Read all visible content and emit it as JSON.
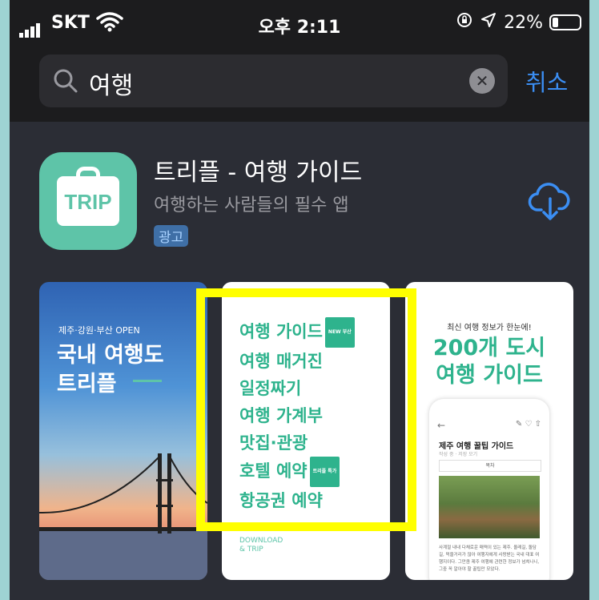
{
  "status_bar": {
    "carrier": "SKT",
    "time": "오후 2:11",
    "battery": "22%",
    "battery_level": 0.22
  },
  "search": {
    "query": "여행",
    "cancel_label": "취소"
  },
  "app": {
    "name": "트리플 - 여행 가이드",
    "subtitle": "여행하는 사람들의 필수 앱",
    "ad_badge": "광고",
    "icon_text": "TRIP"
  },
  "screenshot1": {
    "tag": "제주·강원·부산 OPEN",
    "title_line1": "국내 여행도",
    "title_line2": "트리플"
  },
  "screenshot2": {
    "items": [
      "여행 가이드",
      "여행 매거진",
      "일정짜기",
      "여행 가계부",
      "맛집·관광",
      "호텔 예약",
      "항공권 예약"
    ],
    "badge1": "NEW 부산",
    "badge2": "트리플 특가",
    "footer_line1": "DOWNLOAD",
    "footer_line2": "& TRIP"
  },
  "screenshot3": {
    "small_title": "최신 여행 정보가 한눈에!",
    "title_line1": "200개 도시",
    "title_line2": "여행 가이드",
    "mock_title": "제주 여행 꿀팁 가이드",
    "mock_meta": "작성 중 · 저장 모기",
    "mock_button": "목차",
    "mock_body": "사계절 내내 다채로운 매력이 있는 제주. 올레길, 돌담길, 먹을거리가 많아 여행자에게 사랑받는 국내 대표 여행지이다. 그만큼 제주 여행에 관련한 정보가 넘쳐나니, 그중 꼭 알아야 할 꿀팁만 모았다."
  },
  "colors": {
    "accent": "#2eb38d",
    "link": "#3b8ef3",
    "highlight": "#ffff00",
    "background": "#2b2d35"
  }
}
